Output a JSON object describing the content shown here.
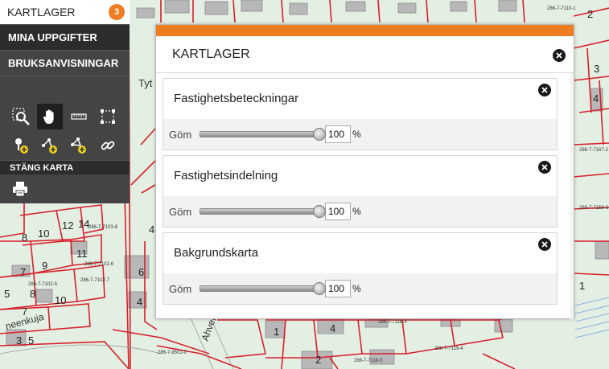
{
  "sidebar": {
    "title": "KARTLAGER",
    "badge": "3",
    "items": [
      {
        "label": "MINA UPPGIFTER"
      },
      {
        "label": "BRUKSANVISNINGAR"
      }
    ],
    "tools_row1": [
      "zoom-box-icon",
      "pan-hand-icon",
      "measure-ruler-icon",
      "select-area-icon"
    ],
    "tools_row2": [
      "add-point-icon",
      "add-line-icon",
      "add-polygon-icon",
      "link-icon"
    ],
    "close_map_label": "STÄNG KARTA",
    "print_icon": "printer-icon"
  },
  "dialog": {
    "title": "KARTLAGER",
    "accent": "#ee7d22",
    "layers": [
      {
        "name": "Fastighetsbeteckningar",
        "hide_label": "Göm",
        "opacity": 100,
        "unit": "%"
      },
      {
        "name": "Fastighetsindelning",
        "hide_label": "Göm",
        "opacity": 100,
        "unit": "%"
      },
      {
        "name": "Bakgrundskarta",
        "hide_label": "Göm",
        "opacity": 100,
        "unit": "%"
      }
    ]
  },
  "map": {
    "street_labels": [
      "Tyt",
      "Ahven",
      "neenkuja"
    ],
    "plot_numbers": [
      "8",
      "10",
      "12",
      "14",
      "4",
      "11",
      "7",
      "9",
      "5",
      "7",
      "6",
      "8",
      "10",
      "4",
      "1",
      "4",
      "2",
      "3",
      "5",
      "1",
      "4",
      "3",
      "2"
    ],
    "small_labels": [
      "286-7-7103-8",
      "286-7-7102-6",
      "286-7-7102-5",
      "286-7-7102-7",
      "286-7-7118-3",
      "286-7-7118-5",
      "286-7-7119-4",
      "286-7-7167-2",
      "286-7-7158-3",
      "286-7-9501-0",
      "286-7-7110-1"
    ]
  }
}
